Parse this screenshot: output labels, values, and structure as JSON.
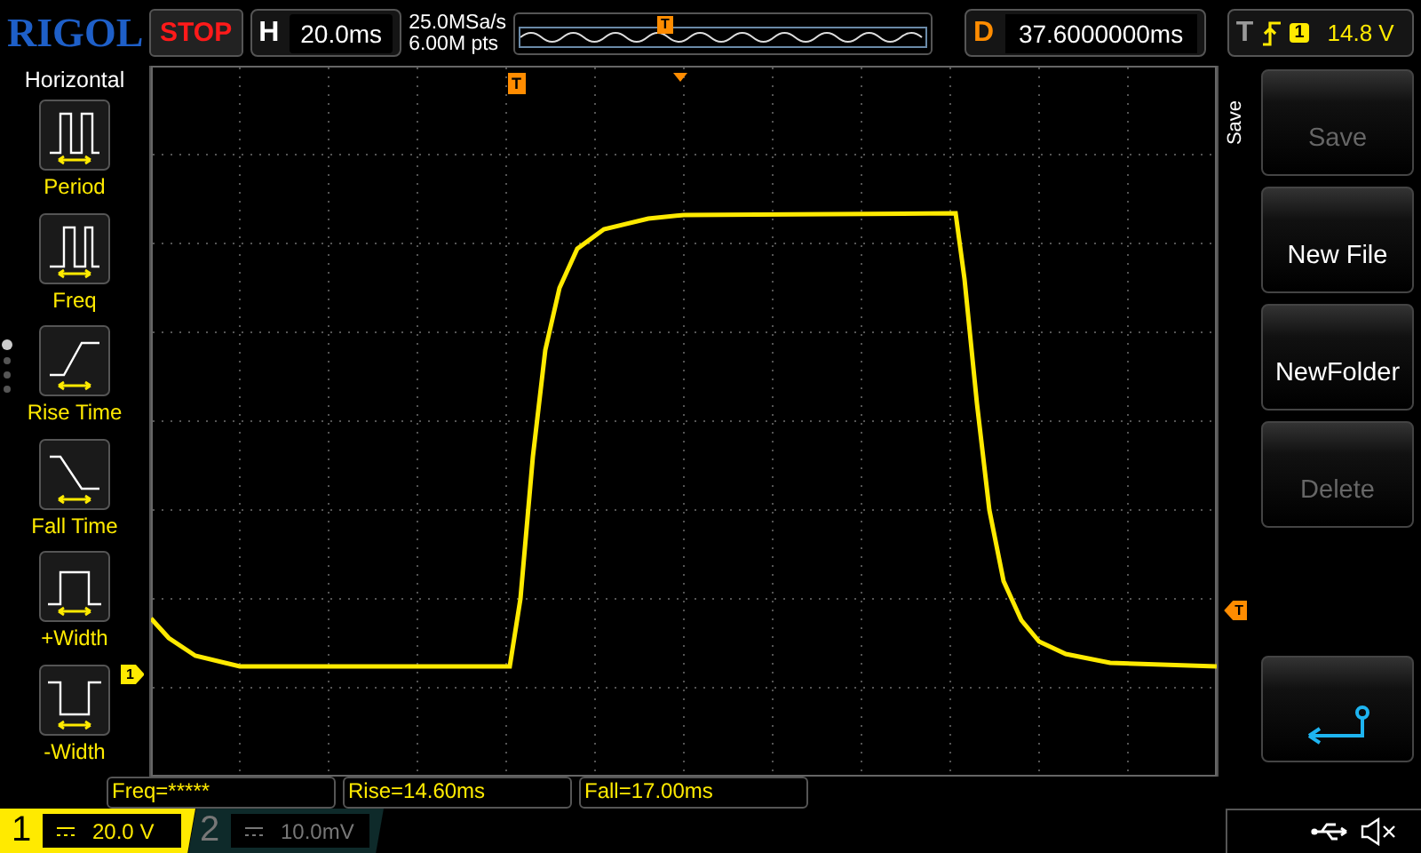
{
  "header": {
    "logo": "RIGOL",
    "run_state": "STOP",
    "timebase": {
      "label": "H",
      "value": "20.0ms"
    },
    "sample_rate": "25.0MSa/s",
    "memory_depth": "6.00M pts",
    "delay": {
      "label": "D",
      "value": "37.6000000ms"
    },
    "trigger": {
      "label": "T",
      "channel": "1",
      "level": "14.8 V"
    }
  },
  "measure_menu": {
    "title": "Horizontal",
    "items": [
      {
        "label": "Period",
        "kind": "period"
      },
      {
        "label": "Freq",
        "kind": "freq"
      },
      {
        "label": "Rise Time",
        "kind": "rise"
      },
      {
        "label": "Fall Time",
        "kind": "fall"
      },
      {
        "label": "+Width",
        "kind": "pwidth"
      },
      {
        "label": "-Width",
        "kind": "nwidth"
      }
    ],
    "pages": [
      {
        "selected": true
      },
      {
        "selected": false
      },
      {
        "selected": false
      },
      {
        "selected": false
      }
    ]
  },
  "markers": {
    "overview_trigger": "T",
    "trigger_position": "T",
    "trigger_level": "T",
    "channel": "1"
  },
  "softkey_menu": {
    "title": "Save",
    "buttons": [
      {
        "kind": "text",
        "label": "Save",
        "disabled": true
      },
      {
        "kind": "text",
        "label": "New File",
        "disabled": false
      },
      {
        "kind": "text",
        "label": "NewFolder",
        "disabled": false
      },
      {
        "kind": "text",
        "label": "Delete",
        "disabled": true
      },
      {
        "kind": "back"
      }
    ]
  },
  "measurements": [
    "Freq=*****",
    "Rise=14.60ms",
    "Fall=17.00ms"
  ],
  "channels": [
    {
      "number": "1",
      "scale": "20.0 V",
      "on": true
    },
    {
      "number": "2",
      "scale": "10.0mV",
      "on": false
    }
  ]
}
